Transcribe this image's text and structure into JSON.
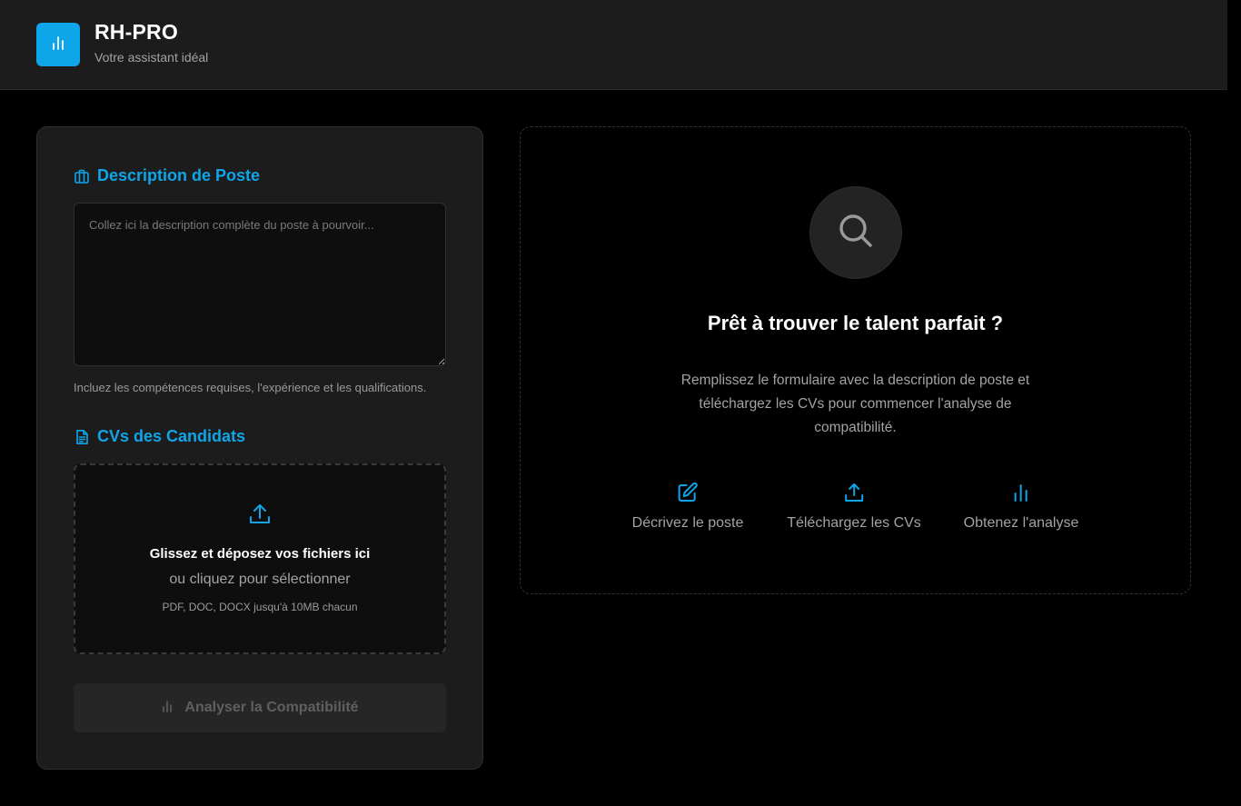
{
  "header": {
    "title": "RH-PRO",
    "subtitle": "Votre assistant idéal",
    "logo_icon": "bar-chart-icon"
  },
  "form": {
    "job_section": {
      "title": "Description de Poste",
      "icon": "briefcase-icon",
      "textarea_value": "",
      "textarea_placeholder": "Collez ici la description complète du poste à pourvoir...",
      "hint": "Incluez les compétences requises, l'expérience et les qualifications."
    },
    "cv_section": {
      "title": "CVs des Candidats",
      "icon": "document-icon",
      "dropzone_title": "Glissez et déposez vos fichiers ici",
      "dropzone_sub": "ou cliquez pour sélectionner",
      "dropzone_types": "PDF, DOC, DOCX jusqu'à 10MB chacun",
      "dropzone_icon": "upload-icon"
    },
    "analyze_button": {
      "label": "Analyser la Compatibilité",
      "icon": "bar-chart-icon",
      "disabled": true
    }
  },
  "empty_state": {
    "icon": "search-icon",
    "title": "Prêt à trouver le talent parfait ?",
    "body": "Remplissez le formulaire avec la description de poste et téléchargez les CVs pour commencer l'analyse de compatibilité.",
    "steps": [
      {
        "label": "Décrivez le poste",
        "icon": "edit-icon"
      },
      {
        "label": "Téléchargez les CVs",
        "icon": "upload-icon"
      },
      {
        "label": "Obtenez l'analyse",
        "icon": "bar-chart-icon"
      }
    ]
  },
  "colors": {
    "accent": "#0ea5e9",
    "background": "#000000",
    "panel": "#1c1c1c",
    "muted_text": "#a3a3a3"
  }
}
